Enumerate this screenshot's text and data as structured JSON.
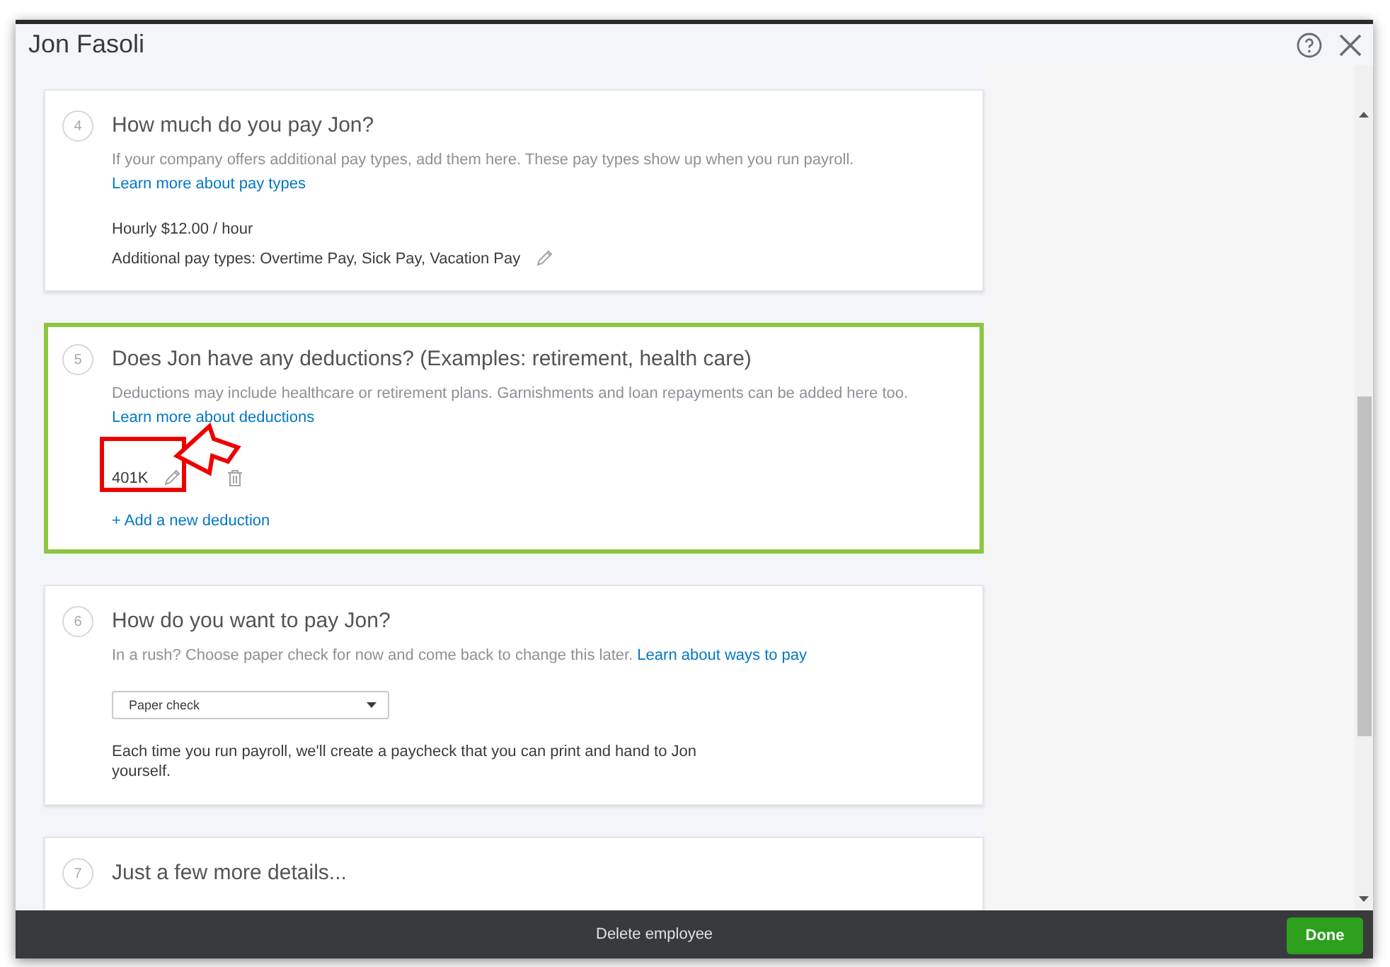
{
  "dialog": {
    "title": "Jon Fasoli"
  },
  "steps": [
    {
      "number": "4",
      "title": "How much do you pay Jon?",
      "highlighted": false,
      "description": "If your company offers additional pay types, add them here. These pay types show up when you run payroll.",
      "link": {
        "label": "Learn more about pay types",
        "kind": "block"
      },
      "body": [
        {
          "kind": "text",
          "text": "Hourly $12.00 / hour"
        },
        {
          "kind": "editable",
          "text": "Additional pay types: Overtime Pay, Sick Pay, Vacation Pay"
        }
      ]
    },
    {
      "number": "5",
      "title": "Does Jon have any deductions? (Examples: retirement, health care)",
      "highlighted": true,
      "description": "Deductions may include healthcare or retirement plans. Garnishments and loan repayments can be added here too.",
      "link": {
        "label": "Learn more about deductions",
        "kind": "block"
      },
      "body": [
        {
          "kind": "deduction",
          "text": "401K"
        },
        {
          "kind": "add",
          "text": "+ Add a new deduction"
        }
      ]
    },
    {
      "number": "6",
      "title": "How do you want to pay Jon?",
      "highlighted": false,
      "description": "In a rush? Choose paper check for now and come back to change this later.",
      "link": {
        "label": "Learn about ways to pay",
        "kind": "inline"
      },
      "body": [
        {
          "kind": "select",
          "text": "Paper check"
        },
        {
          "kind": "note",
          "text": "Each time you run payroll, we'll create a paycheck that you can print and hand to Jon yourself."
        }
      ]
    },
    {
      "number": "7",
      "title": "Just a few more details...",
      "highlighted": false
    }
  ],
  "footer": {
    "delete": "Delete employee",
    "done": "Done"
  }
}
